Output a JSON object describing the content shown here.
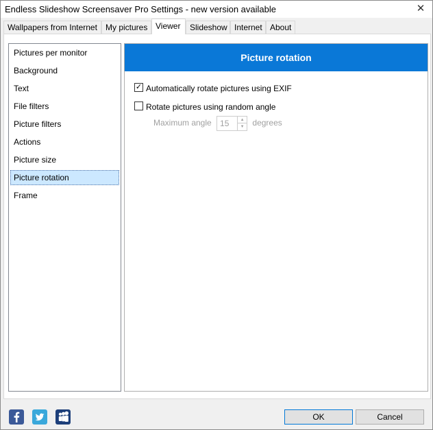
{
  "window": {
    "title": "Endless Slideshow Screensaver Pro Settings - new version available",
    "close_glyph": "✕"
  },
  "tabs": [
    {
      "label": "Wallpapers from Internet"
    },
    {
      "label": "My pictures"
    },
    {
      "label": "Viewer",
      "active": true
    },
    {
      "label": "Slideshow"
    },
    {
      "label": "Internet"
    },
    {
      "label": "About"
    }
  ],
  "nav": {
    "items": [
      {
        "label": "Pictures per monitor"
      },
      {
        "label": "Background"
      },
      {
        "label": "Text"
      },
      {
        "label": "File filters"
      },
      {
        "label": "Picture filters"
      },
      {
        "label": "Actions"
      },
      {
        "label": "Picture size"
      },
      {
        "label": "Picture rotation",
        "selected": true
      },
      {
        "label": "Frame"
      }
    ]
  },
  "content": {
    "header": "Picture rotation",
    "header_color": "#0a78d7",
    "exif": {
      "label": "Automatically rotate pictures using EXIF",
      "checked": true,
      "check_glyph": "✓"
    },
    "random": {
      "label": "Rotate pictures using random angle",
      "checked": false
    },
    "max_angle": {
      "label": "Maximum angle",
      "value": "15",
      "unit": "degrees",
      "up_glyph": "▲",
      "down_glyph": "▼",
      "enabled": false
    }
  },
  "footer": {
    "social": [
      {
        "icon": "facebook-icon",
        "glyph": "f"
      },
      {
        "icon": "twitter-icon"
      },
      {
        "icon": "myspace-icon"
      }
    ],
    "ok_label": "OK",
    "cancel_label": "Cancel"
  }
}
